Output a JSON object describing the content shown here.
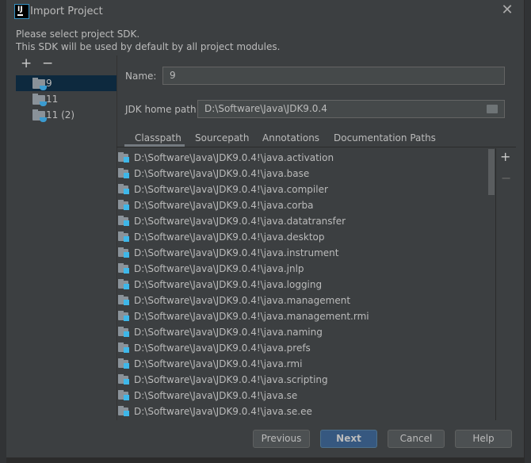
{
  "window": {
    "title": "Import Project",
    "close_icon": "close-icon"
  },
  "description": [
    "Please select project SDK.",
    "This SDK will be used by default by all project modules."
  ],
  "sdk_toolbar": {
    "add": "+",
    "remove": "−"
  },
  "sdk_list": [
    {
      "label": "9",
      "selected": true
    },
    {
      "label": "11",
      "selected": false
    },
    {
      "label": "11 (2)",
      "selected": false
    }
  ],
  "name": {
    "label": "Name:",
    "value": "9"
  },
  "jdk_home": {
    "label": "JDK home path:",
    "value": "D:\\Software\\Java\\JDK9.0.4"
  },
  "tabs": [
    {
      "label": "Classpath",
      "active": true
    },
    {
      "label": "Sourcepath"
    },
    {
      "label": "Annotations"
    },
    {
      "label": "Documentation Paths"
    }
  ],
  "classpath": [
    "D:\\Software\\Java\\JDK9.0.4!\\java.activation",
    "D:\\Software\\Java\\JDK9.0.4!\\java.base",
    "D:\\Software\\Java\\JDK9.0.4!\\java.compiler",
    "D:\\Software\\Java\\JDK9.0.4!\\java.corba",
    "D:\\Software\\Java\\JDK9.0.4!\\java.datatransfer",
    "D:\\Software\\Java\\JDK9.0.4!\\java.desktop",
    "D:\\Software\\Java\\JDK9.0.4!\\java.instrument",
    "D:\\Software\\Java\\JDK9.0.4!\\java.jnlp",
    "D:\\Software\\Java\\JDK9.0.4!\\java.logging",
    "D:\\Software\\Java\\JDK9.0.4!\\java.management",
    "D:\\Software\\Java\\JDK9.0.4!\\java.management.rmi",
    "D:\\Software\\Java\\JDK9.0.4!\\java.naming",
    "D:\\Software\\Java\\JDK9.0.4!\\java.prefs",
    "D:\\Software\\Java\\JDK9.0.4!\\java.rmi",
    "D:\\Software\\Java\\JDK9.0.4!\\java.scripting",
    "D:\\Software\\Java\\JDK9.0.4!\\java.se",
    "D:\\Software\\Java\\JDK9.0.4!\\java.se.ee"
  ],
  "list_toolbar": {
    "add": "+",
    "remove": "−"
  },
  "buttons": {
    "previous": "Previous",
    "next": "Next",
    "cancel": "Cancel",
    "help": "Help"
  },
  "colors": {
    "dialog_bg": "#3c3f41",
    "selection": "#0d293e",
    "default_button": "#365880"
  }
}
